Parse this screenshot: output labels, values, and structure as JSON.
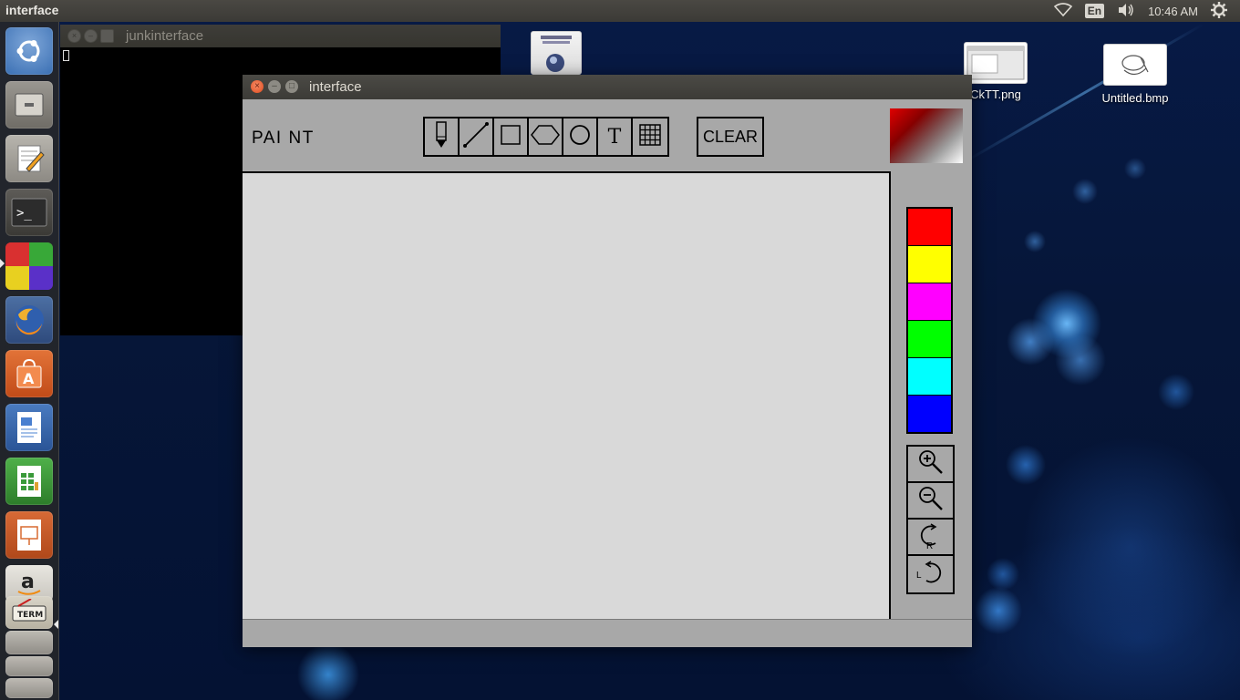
{
  "top_panel": {
    "app_title": "interface",
    "language": "En",
    "clock": "10:46 AM"
  },
  "launcher": {
    "items": [
      {
        "name": "ubuntu-dash",
        "icon": "ubuntu-logo-icon"
      },
      {
        "name": "files",
        "icon": "file-cabinet-icon"
      },
      {
        "name": "text-editor",
        "icon": "text-editor-icon"
      },
      {
        "name": "terminal",
        "icon": "terminal-icon"
      },
      {
        "name": "workspace-switcher",
        "icon": "workspaces-icon"
      },
      {
        "name": "firefox",
        "icon": "firefox-icon"
      },
      {
        "name": "software-center",
        "icon": "shopping-bag-icon"
      },
      {
        "name": "libreoffice-writer",
        "icon": "writer-icon"
      },
      {
        "name": "libreoffice-calc",
        "icon": "calc-icon"
      },
      {
        "name": "libreoffice-impress",
        "icon": "impress-icon"
      },
      {
        "name": "amazon",
        "icon": "amazon-icon"
      },
      {
        "name": "xterm-stack",
        "icon": "xterm-icon"
      }
    ]
  },
  "desktop_icons": [
    {
      "label": "CkTT.png"
    },
    {
      "label": "Untitled.bmp"
    }
  ],
  "terminal_window": {
    "title": "junkinterface"
  },
  "paint_window": {
    "title": "interface",
    "app_label": "PAI NT",
    "clear_label": "CLEAR",
    "text_tool_glyph": "T",
    "tools": [
      "pencil-icon",
      "line-icon",
      "rectangle-icon",
      "polygon-icon",
      "circle-icon",
      "text-icon",
      "grid-icon"
    ],
    "palette_colors": [
      "#ff0000",
      "#ffff00",
      "#ff00ff",
      "#00ff00",
      "#00ffff",
      "#0000ff"
    ],
    "preview_colors": {
      "from": "#e00000",
      "to": "#ffffff"
    },
    "rotate_labels": {
      "right": "R",
      "left": "L"
    }
  }
}
